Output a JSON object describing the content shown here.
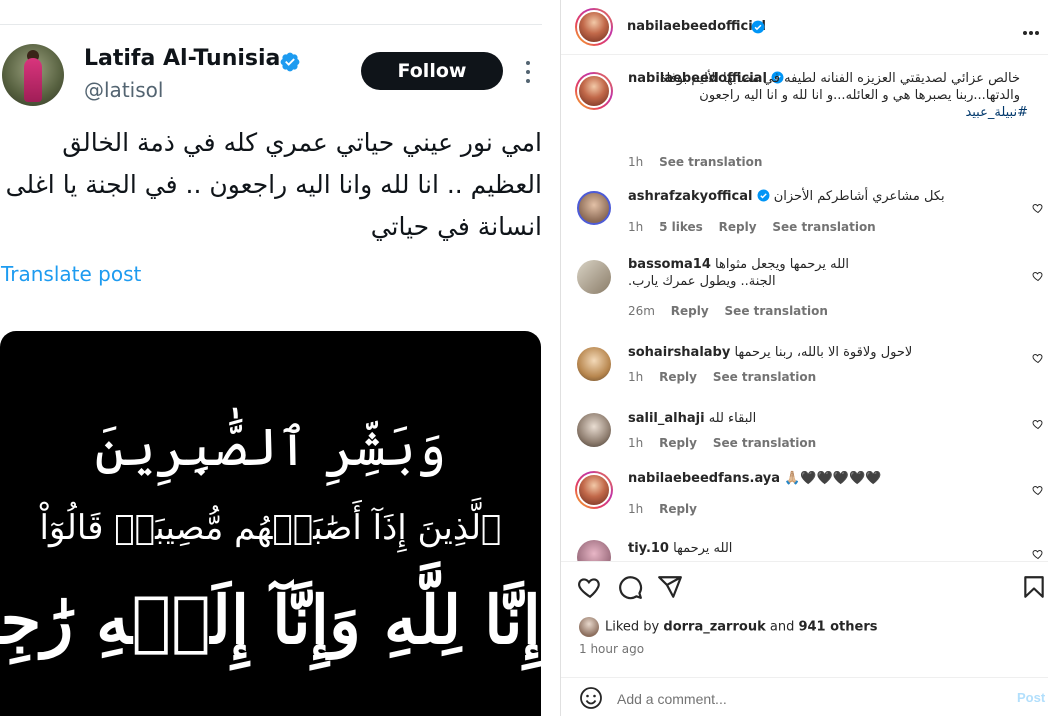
{
  "tweet": {
    "author_name": "Latifa Al-Tunisia",
    "handle": "@latisol",
    "follow_label": "Follow",
    "text": "امي نور عيني حياتي عمري كله في ذمة الخالق العظيم .. انا لله وانا اليه راجعون .. في الجنة يا اغلى انسانة في حياتي",
    "translate_label": "Translate post",
    "image_lines": [
      "وَبَشِّرِ ٱلصَّٰبِرِينَ",
      "ٱلَّذِينَ إِذَآ أَصَٰبَتۡهُم مُّصِيبَةٞ قَالُوٓاْ",
      "إِنَّا لِلَّهِ وَإِنَّآ إِلَيۡهِ رَٰجِعُونَ"
    ],
    "colors": {
      "follow_bg": "#0f1419",
      "link": "#1d9bf0",
      "verified": "#1d9bf0"
    }
  },
  "instagram": {
    "post_author": "nabilaebeedofficial",
    "caption": {
      "username": "nabilaebeedofficial",
      "text": "خالص عزائي لصديقتي العزيزه الفنانه لطيفه في مصابها الأليم بوفاة والدتها...ربنا يصبرها هي و العائله...و انا لله و انا اليه راجعون",
      "hashtag": "#نبيلة_عبيد",
      "time": "1h",
      "see_translation": "See translation"
    },
    "comments": [
      {
        "username": "ashrafzakyoffical",
        "verified": true,
        "text": "بكل مشاعري أشاطركم الأحزان",
        "time": "1h",
        "likes": "5 likes",
        "reply": "Reply",
        "see_translation": "See translation"
      },
      {
        "username": "bassoma14",
        "verified": false,
        "text": "الله يرحمها ويجعل مثواها الجنة.. ويطول عمرك يارب.",
        "time": "26m",
        "likes": "",
        "reply": "Reply",
        "see_translation": "See translation"
      },
      {
        "username": "sohairshalaby",
        "verified": false,
        "text": "لاحول ولاقوة الا بالله، ربنا يرحمها",
        "time": "1h",
        "likes": "",
        "reply": "Reply",
        "see_translation": "See translation"
      },
      {
        "username": "salil_alhaji",
        "verified": false,
        "text": "البقاء لله",
        "time": "1h",
        "likes": "",
        "reply": "Reply",
        "see_translation": "See translation"
      },
      {
        "username": "nabilaebeedfans.aya",
        "verified": false,
        "text": "🙏🏼🖤🖤🖤🖤🖤",
        "time": "1h",
        "likes": "",
        "reply": "Reply",
        "see_translation": ""
      },
      {
        "username": "tiy.10",
        "verified": false,
        "text": "الله يرحمها",
        "time": "",
        "likes": "",
        "reply": "",
        "see_translation": ""
      }
    ],
    "liked_by": {
      "prefix": "Liked by",
      "user": "dorra_zarrouk",
      "middle": "and",
      "others": "941 others"
    },
    "timestamp": "1 hour ago",
    "add_comment_placeholder": "Add a comment...",
    "post_label": "Post",
    "icons": [
      "heart-icon",
      "comment-icon",
      "share-icon",
      "bookmark-icon",
      "emoji-icon",
      "more-icon",
      "verified-icon"
    ],
    "colors": {
      "verified": "#0095f6",
      "post_disabled": "#b2dffc",
      "muted": "#737373"
    }
  }
}
